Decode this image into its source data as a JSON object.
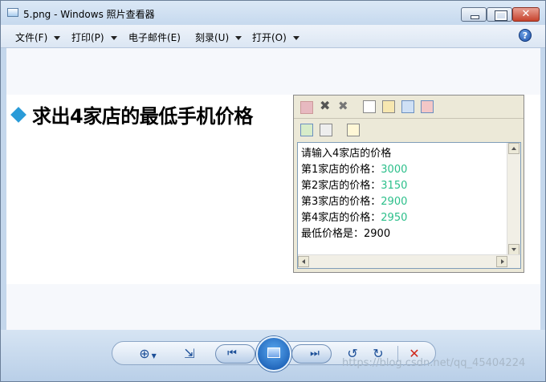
{
  "window": {
    "title": "5.png - Windows 照片查看器",
    "close_glyph": "✕"
  },
  "menu": {
    "items": [
      {
        "label": "文件(F)",
        "has_arrow": true
      },
      {
        "label": "打印(P)",
        "has_arrow": true
      },
      {
        "label": "电子邮件(E)",
        "has_arrow": false
      },
      {
        "label": "刻录(U)",
        "has_arrow": true
      },
      {
        "label": "打开(O)",
        "has_arrow": true
      }
    ],
    "help_label": "?"
  },
  "image": {
    "heading": "求出4家店的最低手机价格",
    "console_lines": [
      {
        "prefix": "请输入4家店的价格",
        "value": ""
      },
      {
        "prefix": "第1家店的价格：",
        "value": "3000"
      },
      {
        "prefix": "第2家店的价格：",
        "value": "3150"
      },
      {
        "prefix": "第3家店的价格：",
        "value": "2900"
      },
      {
        "prefix": "第4家店的价格：",
        "value": "2950"
      },
      {
        "prefix": "最低价格是：2900",
        "value": ""
      }
    ],
    "value_color": "#2bbf8a"
  },
  "controls": {
    "zoom_glyph": "⊕",
    "fit_glyph": "⇲",
    "prev_glyph": "⏮",
    "next_glyph": "⏭",
    "rotate_ccw_glyph": "↺",
    "rotate_cw_glyph": "↻",
    "delete_glyph": "✕"
  },
  "watermark": "https://blog.csdn.net/qq_45404224"
}
